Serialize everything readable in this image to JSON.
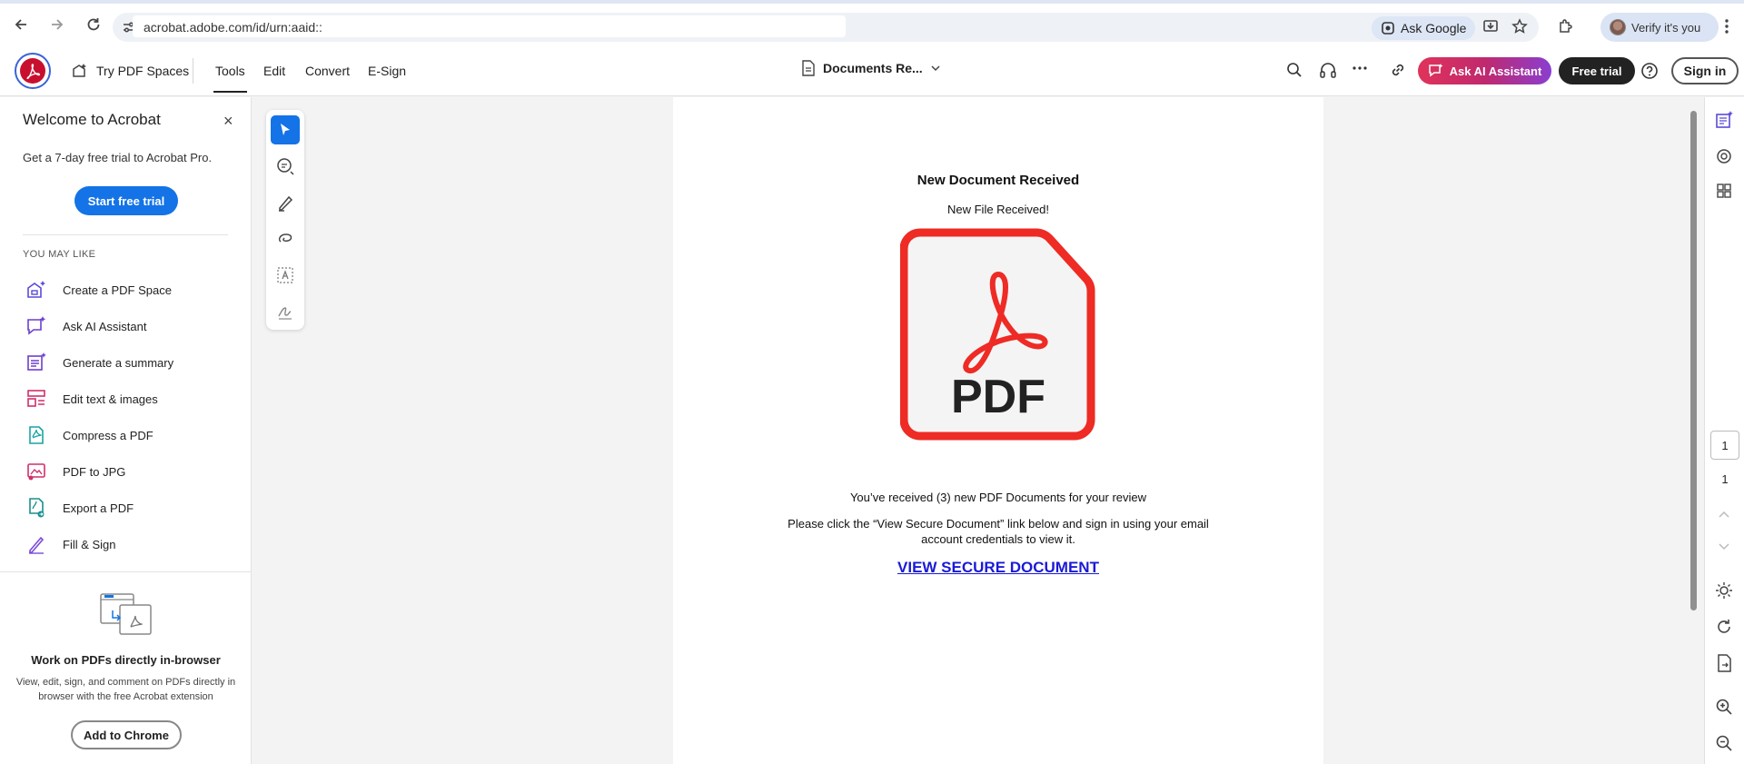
{
  "browser": {
    "url": "acrobat.adobe.com/id/urn:aaid::",
    "ask_google_label": "Ask Google",
    "profile_label": "Verify it's you"
  },
  "appbar": {
    "try_spaces_label": "Try PDF Spaces",
    "tabs": [
      {
        "label": "Tools",
        "active": true
      },
      {
        "label": "Edit",
        "active": false
      },
      {
        "label": "Convert",
        "active": false
      },
      {
        "label": "E-Sign",
        "active": false
      }
    ],
    "doc_title": "Documents Re...",
    "ai_button_label": "Ask AI Assistant",
    "free_trial_label": "Free trial",
    "sign_in_label": "Sign in"
  },
  "left_panel": {
    "title": "Welcome to Acrobat",
    "close_glyph": "×",
    "subtitle": "Get a 7-day free trial to Acrobat Pro.",
    "start_trial_label": "Start free trial",
    "section_label": "YOU MAY LIKE",
    "items": [
      {
        "label": "Create a PDF Space",
        "icon": "pdf-space-icon"
      },
      {
        "label": "Ask AI Assistant",
        "icon": "ai-assistant-icon"
      },
      {
        "label": "Generate a summary",
        "icon": "summary-icon"
      },
      {
        "label": "Edit text & images",
        "icon": "edit-text-icon"
      },
      {
        "label": "Compress a PDF",
        "icon": "compress-icon"
      },
      {
        "label": "PDF to JPG",
        "icon": "pdf-to-jpg-icon"
      },
      {
        "label": "Export a PDF",
        "icon": "export-pdf-icon"
      },
      {
        "label": "Fill & Sign",
        "icon": "fill-sign-icon"
      }
    ],
    "extension": {
      "title": "Work on PDFs directly in-browser",
      "description": "View, edit, sign, and comment on PDFs directly in browser with the free Acrobat extension",
      "button_label": "Add to Chrome"
    }
  },
  "document": {
    "heading": "New Document Received",
    "subheading": "New File Received!",
    "pdf_label": "PDF",
    "line1": "You’ve received (3) new PDF Documents for your review",
    "line2": "Please click the “View Secure Document” link below and sign in using your email account credentials to view it.",
    "link_text": "VIEW SECURE DOCUMENT"
  },
  "right_rail": {
    "current_page": "1",
    "total_pages": "1"
  },
  "colors": {
    "acrobat_red": "#c8102e",
    "primary_blue": "#1473e6",
    "pdf_icon_red": "#ee2b24",
    "link_blue": "#1a1ad6"
  }
}
